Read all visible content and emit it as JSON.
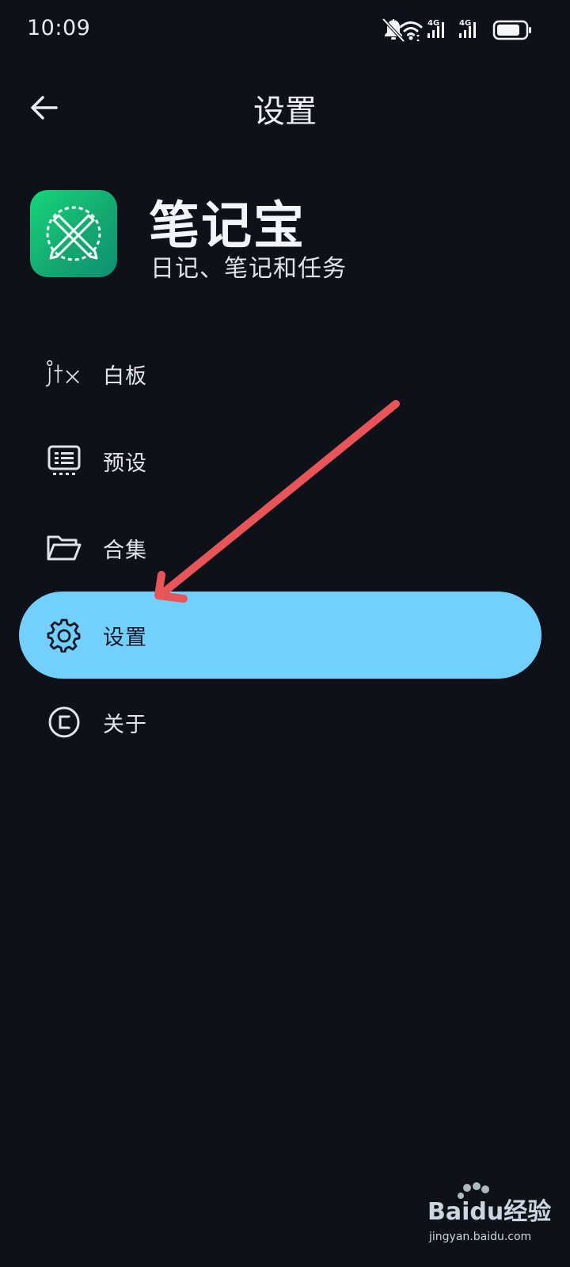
{
  "status_bar": {
    "time": "10:09",
    "network_4g_1": "4G",
    "network_4g_2": "4G"
  },
  "app_bar": {
    "title": "设置"
  },
  "header": {
    "app_name": "笔记宝",
    "subtitle": "日记、笔记和任务"
  },
  "drawer": {
    "items": [
      {
        "label": "白板",
        "icon": "jtx-icon",
        "selected": false
      },
      {
        "label": "预设",
        "icon": "presets-icon",
        "selected": false
      },
      {
        "label": "合集",
        "icon": "folder-icon",
        "selected": false
      },
      {
        "label": "设置",
        "icon": "gear-icon",
        "selected": true
      },
      {
        "label": "关于",
        "icon": "copyright-icon",
        "selected": false
      }
    ]
  },
  "watermark": {
    "brand": "Baidu经验",
    "url": "jingyan.baidu.com"
  },
  "colors": {
    "background": "#0d121a",
    "selected_item": "#73cffd",
    "annotation_arrow": "#e85558",
    "logo_green": "#14a970"
  }
}
